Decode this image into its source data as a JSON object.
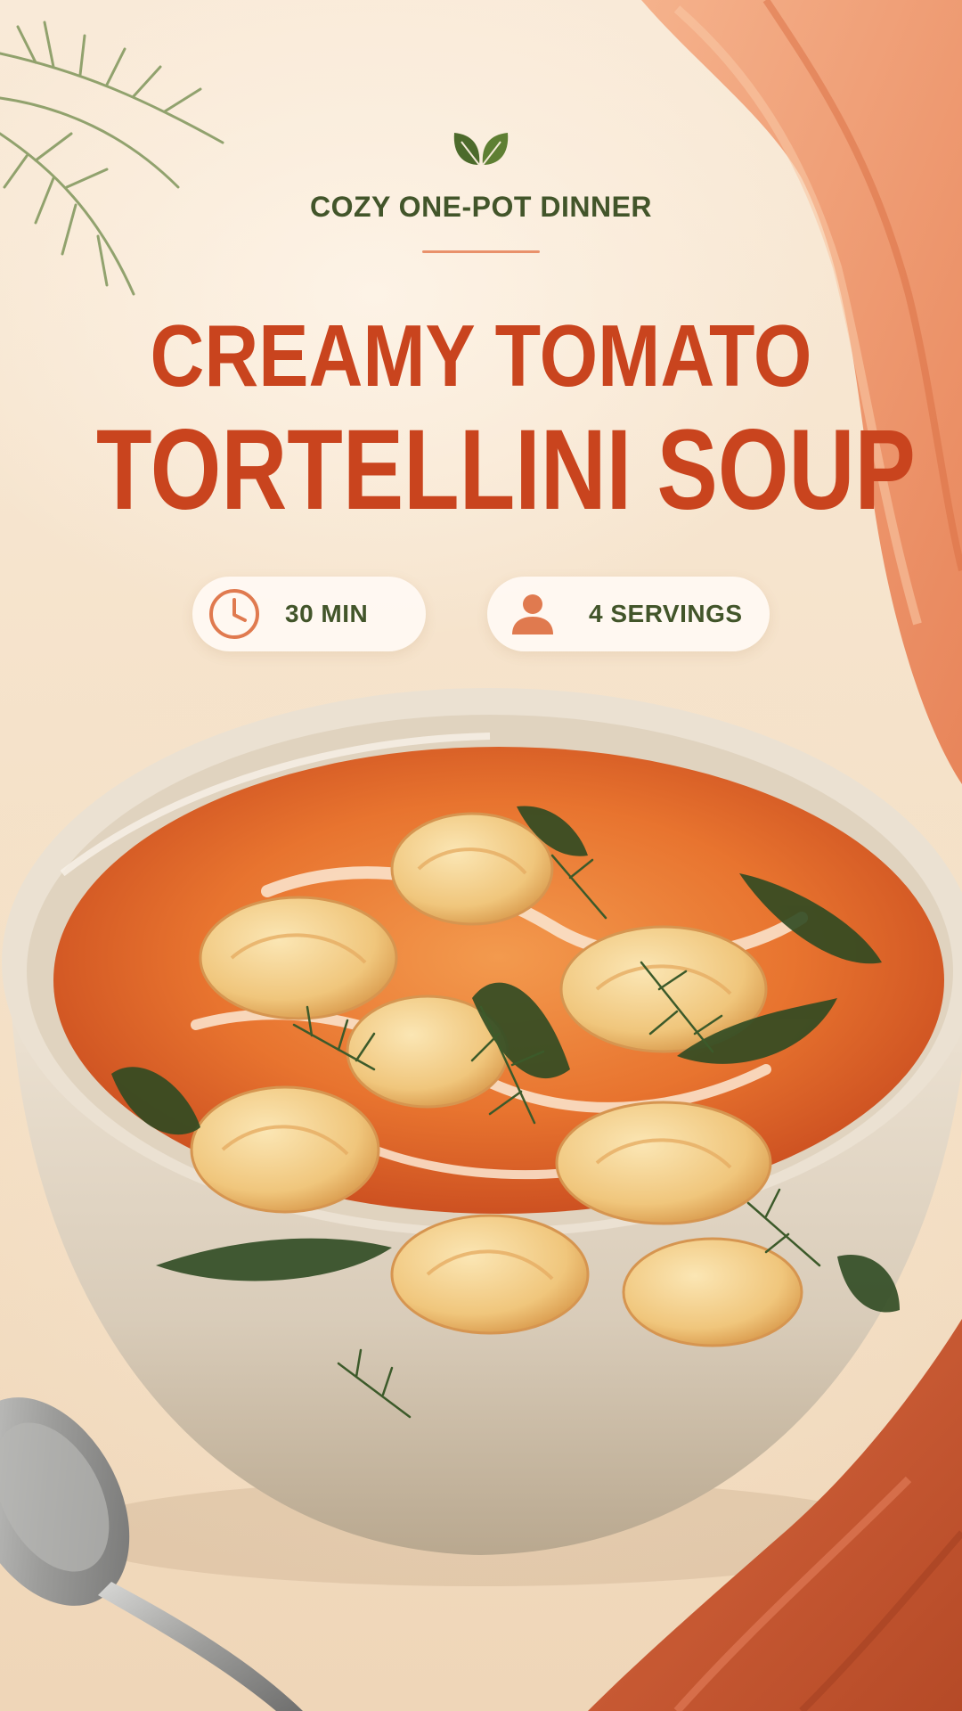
{
  "header": {
    "icon": "leaf-icon",
    "kicker": "COZY ONE-POT DINNER",
    "title_line_1": "CREAMY TOMATO",
    "title_line_2": "TORTELLINI SOUP"
  },
  "badges": [
    {
      "icon": "clock-icon",
      "label": "30 MIN"
    },
    {
      "icon": "person-icon",
      "label": "4 SERVINGS"
    }
  ],
  "colors": {
    "title": "#c9441e",
    "kicker": "#42552a",
    "accent": "#e9916b",
    "background": "#f6e5cf",
    "soup": "#e8742f",
    "bowl": "#e8dccb",
    "napkin": "#e27a52"
  },
  "photo": {
    "subject": "bowl-of-soup",
    "props": [
      "dill-sprig",
      "spoon",
      "napkin"
    ]
  }
}
